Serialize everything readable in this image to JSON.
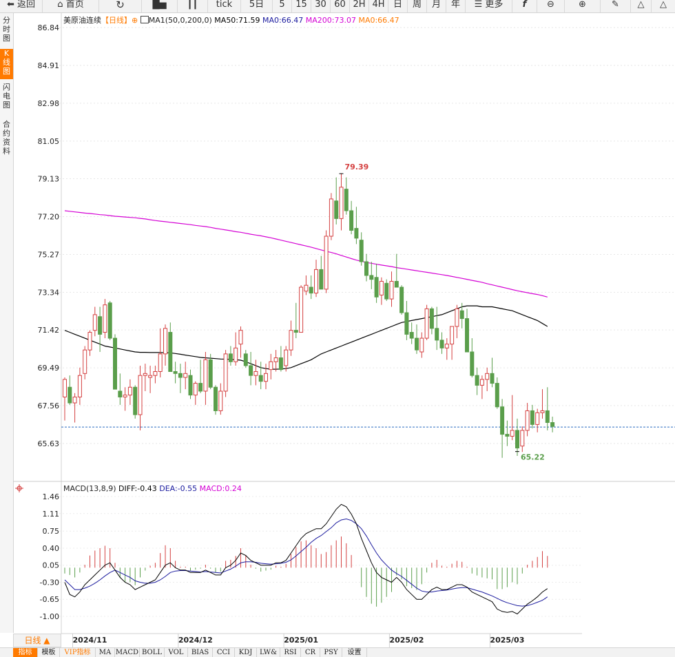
{
  "toolbar": {
    "back": "返回",
    "home": "首页",
    "tick": "tick",
    "d5": "5日",
    "m5": "5",
    "m15": "15",
    "m30": "30",
    "m60": "60",
    "h2": "2H",
    "h4": "4H",
    "day": "日",
    "week": "周",
    "month": "月",
    "year": "年",
    "more": "更多",
    "icons": [
      "back-arrow-icon",
      "home-icon",
      "refresh-icon",
      "bar-chart-icon",
      "candlestick-icon",
      "hamburger-icon",
      "function-icon",
      "zoom-out-icon",
      "zoom-in-icon",
      "pen-icon",
      "triangle-icon",
      "triangle-outline-icon"
    ]
  },
  "side_tabs": [
    {
      "label": "分时图",
      "active": false
    },
    {
      "label": "K线图",
      "active": true
    },
    {
      "label": "闪电图",
      "active": false
    },
    {
      "label": "合约资料",
      "active": false
    }
  ],
  "main_legend": {
    "symbol": "美原油连续",
    "period": "【日线】",
    "ma_params": "MA1(50,0,200,0)",
    "ma50": "MA50:71.59",
    "ma0": "MA0:66.47",
    "ma200": "MA200:73.07",
    "ma0b": "MA0:66.47"
  },
  "sub_legend": {
    "title": "MACD(13,8,9)",
    "diff": "DIFF:-0.43",
    "dea": "DEA:-0.55",
    "macd": "MACD:0.24"
  },
  "period_button": "日线 ▲",
  "bottom_tabs": [
    "指标",
    "模板",
    "VIP指标",
    "MA",
    "MACD",
    "BOLL",
    "VOL",
    "BIAS",
    "CCI",
    "KDJ",
    "LW&",
    "RSI",
    "CR",
    "PSY",
    "设置"
  ],
  "colors": {
    "up": "#d43f3f",
    "down": "#5a9e4b",
    "ma50": "#000000",
    "ma200": "#d400d4",
    "diff": "#000000",
    "dea": "#1a1a9e",
    "current_line": "#2a6cc0",
    "accent": "#ff7a00"
  },
  "chart_data": [
    {
      "type": "candlestick",
      "title": "美原油连续【日线】",
      "ylim": [
        65.0,
        87.5
      ],
      "yticks": [
        "86.84",
        "84.91",
        "82.98",
        "81.05",
        "79.13",
        "77.20",
        "75.27",
        "73.34",
        "71.42",
        "69.49",
        "67.56",
        "65.63"
      ],
      "x_labels": [
        "2024/11",
        "2024/12",
        "2025/01",
        "2025/02",
        "2025/03"
      ],
      "x_label_at": [
        5,
        26,
        47,
        68,
        88
      ],
      "current_price": 66.47,
      "high_label": "79.39",
      "high_index": 55,
      "low_label": "65.22",
      "low_index": 90,
      "ohlc": [
        [
          68.0,
          69.0,
          66.8,
          68.9
        ],
        [
          68.5,
          69.1,
          67.6,
          67.7
        ],
        [
          67.7,
          68.2,
          66.7,
          68.0
        ],
        [
          68.0,
          69.5,
          67.6,
          69.1
        ],
        [
          69.2,
          70.6,
          68.9,
          70.4
        ],
        [
          70.4,
          71.4,
          70.1,
          71.3
        ],
        [
          71.4,
          72.6,
          71.1,
          72.2
        ],
        [
          72.1,
          72.6,
          70.3,
          71.2
        ],
        [
          71.3,
          73.0,
          71.0,
          72.7
        ],
        [
          72.8,
          72.9,
          70.9,
          71.0
        ],
        [
          71.0,
          71.2,
          68.5,
          68.4
        ],
        [
          68.3,
          69.2,
          67.6,
          68.0
        ],
        [
          68.0,
          68.5,
          67.3,
          68.1
        ],
        [
          68.1,
          68.9,
          67.6,
          68.5
        ],
        [
          68.5,
          68.6,
          66.9,
          67.1
        ],
        [
          67.1,
          69.6,
          66.3,
          69.1
        ],
        [
          69.1,
          69.7,
          68.3,
          69.2
        ],
        [
          69.0,
          69.6,
          68.2,
          69.1
        ],
        [
          69.1,
          69.6,
          68.7,
          69.3
        ],
        [
          69.3,
          71.5,
          69.0,
          70.2
        ],
        [
          70.2,
          71.7,
          69.6,
          71.5
        ],
        [
          71.3,
          71.8,
          69.3,
          69.3
        ],
        [
          69.3,
          69.8,
          68.7,
          69.2
        ],
        [
          69.2,
          69.7,
          68.2,
          69.0
        ],
        [
          69.0,
          69.8,
          68.4,
          69.2
        ],
        [
          69.1,
          69.4,
          67.9,
          68.1
        ],
        [
          68.1,
          68.8,
          67.6,
          68.7
        ],
        [
          68.7,
          69.9,
          68.2,
          68.3
        ],
        [
          68.3,
          70.3,
          67.6,
          69.9
        ],
        [
          69.9,
          70.2,
          68.4,
          68.5
        ],
        [
          68.5,
          68.6,
          67.1,
          67.3
        ],
        [
          67.3,
          68.7,
          67.1,
          68.3
        ],
        [
          68.3,
          70.4,
          68.0,
          70.2
        ],
        [
          70.2,
          70.6,
          69.6,
          69.8
        ],
        [
          69.8,
          71.3,
          69.6,
          70.5
        ],
        [
          70.7,
          71.6,
          70.0,
          71.4
        ],
        [
          70.2,
          70.4,
          69.5,
          69.6
        ],
        [
          69.6,
          70.3,
          68.6,
          69.1
        ],
        [
          69.1,
          69.9,
          68.6,
          69.3
        ],
        [
          69.1,
          69.8,
          68.4,
          68.8
        ],
        [
          68.8,
          69.7,
          68.4,
          69.2
        ],
        [
          69.4,
          70.2,
          68.9,
          69.8
        ],
        [
          69.8,
          70.4,
          69.3,
          70.0
        ],
        [
          70.0,
          70.6,
          69.3,
          69.4
        ],
        [
          69.6,
          70.6,
          69.3,
          70.4
        ],
        [
          70.4,
          71.9,
          70.1,
          71.4
        ],
        [
          71.4,
          72.8,
          71.0,
          71.3
        ],
        [
          71.3,
          73.7,
          71.3,
          73.6
        ],
        [
          73.4,
          74.2,
          73.2,
          73.7
        ],
        [
          73.6,
          74.2,
          73.0,
          73.3
        ],
        [
          73.3,
          75.0,
          73.1,
          74.5
        ],
        [
          74.5,
          75.2,
          73.5,
          73.5
        ],
        [
          73.5,
          76.5,
          73.3,
          76.2
        ],
        [
          76.2,
          78.4,
          76.0,
          78.1
        ],
        [
          78.0,
          79.2,
          76.8,
          77.1
        ],
        [
          77.1,
          79.39,
          76.5,
          78.7
        ],
        [
          78.6,
          79.2,
          77.3,
          77.5
        ],
        [
          77.5,
          78.0,
          76.3,
          76.5
        ],
        [
          76.6,
          77.7,
          75.8,
          76.1
        ],
        [
          76.0,
          76.4,
          74.7,
          74.9
        ],
        [
          74.9,
          75.3,
          73.9,
          74.2
        ],
        [
          74.2,
          74.9,
          73.5,
          74.0
        ],
        [
          74.1,
          74.8,
          72.8,
          73.1
        ],
        [
          73.2,
          74.1,
          72.7,
          73.9
        ],
        [
          73.8,
          74.0,
          72.9,
          73.0
        ],
        [
          73.0,
          74.4,
          72.6,
          73.9
        ],
        [
          73.9,
          75.3,
          73.6,
          73.6
        ],
        [
          73.6,
          73.7,
          72.2,
          72.3
        ],
        [
          72.3,
          72.9,
          70.9,
          71.2
        ],
        [
          71.3,
          71.8,
          70.7,
          71.0
        ],
        [
          71.0,
          71.7,
          70.2,
          70.4
        ],
        [
          70.3,
          71.3,
          70.0,
          71.0
        ],
        [
          71.0,
          72.7,
          70.9,
          72.5
        ],
        [
          72.5,
          72.6,
          71.2,
          71.5
        ],
        [
          71.5,
          72.6,
          70.4,
          70.9
        ],
        [
          70.9,
          71.3,
          70.2,
          70.5
        ],
        [
          70.5,
          71.0,
          69.9,
          70.7
        ],
        [
          70.7,
          71.6,
          69.9,
          71.6
        ],
        [
          71.6,
          72.7,
          71.0,
          72.5
        ],
        [
          72.4,
          72.8,
          71.5,
          72.0
        ],
        [
          72.0,
          72.5,
          70.3,
          70.3
        ],
        [
          70.3,
          71.0,
          69.0,
          69.1
        ],
        [
          69.1,
          69.5,
          68.1,
          68.6
        ],
        [
          68.6,
          69.1,
          67.9,
          68.9
        ],
        [
          68.9,
          69.5,
          68.3,
          69.2
        ],
        [
          69.2,
          70.0,
          68.5,
          68.7
        ],
        [
          68.7,
          69.0,
          67.4,
          67.5
        ],
        [
          67.5,
          67.9,
          64.9,
          66.1
        ],
        [
          66.1,
          66.8,
          65.5,
          66.0
        ],
        [
          66.0,
          68.1,
          65.8,
          66.3
        ],
        [
          66.3,
          66.9,
          65.0,
          65.4
        ],
        [
          65.5,
          66.5,
          65.2,
          66.3
        ],
        [
          66.3,
          67.7,
          66.0,
          67.3
        ],
        [
          67.3,
          67.6,
          66.4,
          66.6
        ],
        [
          66.6,
          67.4,
          66.2,
          67.2
        ],
        [
          67.2,
          68.4,
          66.9,
          67.3
        ],
        [
          67.3,
          68.5,
          66.3,
          66.7
        ],
        [
          66.7,
          67.0,
          66.2,
          66.5
        ]
      ],
      "ma50": [
        71.4,
        71.3,
        71.2,
        71.1,
        71.0,
        70.9,
        70.8,
        70.7,
        70.6,
        70.55,
        70.5,
        70.45,
        70.4,
        70.35,
        70.3,
        70.28,
        70.28,
        70.27,
        70.27,
        70.27,
        70.26,
        70.25,
        70.22,
        70.18,
        70.14,
        70.1,
        70.06,
        70.02,
        70.0,
        69.98,
        69.96,
        69.94,
        69.93,
        69.92,
        69.9,
        69.88,
        69.8,
        69.7,
        69.6,
        69.5,
        69.45,
        69.42,
        69.42,
        69.43,
        69.45,
        69.5,
        69.6,
        69.7,
        69.8,
        69.9,
        70.05,
        70.2,
        70.3,
        70.4,
        70.5,
        70.6,
        70.7,
        70.8,
        70.9,
        71.0,
        71.1,
        71.2,
        71.3,
        71.4,
        71.5,
        71.6,
        71.7,
        71.8,
        71.85,
        71.9,
        71.95,
        72.0,
        72.05,
        72.1,
        72.15,
        72.2,
        72.3,
        72.4,
        72.5,
        72.6,
        72.65,
        72.65,
        72.65,
        72.6,
        72.6,
        72.6,
        72.55,
        72.5,
        72.45,
        72.4,
        72.3,
        72.2,
        72.1,
        72.0,
        71.9,
        71.75,
        71.6
      ],
      "ma200": [
        77.5,
        77.47,
        77.44,
        77.41,
        77.38,
        77.36,
        77.33,
        77.3,
        77.28,
        77.25,
        77.22,
        77.2,
        77.18,
        77.16,
        77.14,
        77.11,
        77.08,
        77.04,
        77.0,
        76.97,
        76.94,
        76.91,
        76.88,
        76.85,
        76.82,
        76.79,
        76.75,
        76.72,
        76.69,
        76.65,
        76.6,
        76.56,
        76.52,
        76.48,
        76.43,
        76.4,
        76.35,
        76.3,
        76.26,
        76.22,
        76.17,
        76.12,
        76.06,
        76.0,
        75.94,
        75.88,
        75.82,
        75.76,
        75.7,
        75.64,
        75.57,
        75.5,
        75.43,
        75.37,
        75.3,
        75.22,
        75.14,
        75.06,
        74.98,
        74.92,
        74.86,
        74.82,
        74.77,
        74.73,
        74.69,
        74.65,
        74.6,
        74.56,
        74.52,
        74.48,
        74.44,
        74.4,
        74.36,
        74.32,
        74.28,
        74.24,
        74.2,
        74.15,
        74.1,
        74.05,
        74.0,
        73.95,
        73.9,
        73.85,
        73.78,
        73.72,
        73.66,
        73.6,
        73.54,
        73.48,
        73.42,
        73.37,
        73.32,
        73.27,
        73.23,
        73.17,
        73.1
      ]
    },
    {
      "type": "macd",
      "title": "MACD(13,8,9)",
      "ylim": [
        -1.3,
        1.6
      ],
      "yticks": [
        "1.46",
        "1.11",
        "0.75",
        "0.40",
        "0.05",
        "-0.30",
        "-0.65",
        "-1.00"
      ],
      "diff": [
        -0.3,
        -0.55,
        -0.6,
        -0.5,
        -0.35,
        -0.25,
        -0.15,
        -0.05,
        0.05,
        0.1,
        -0.05,
        -0.2,
        -0.3,
        -0.35,
        -0.45,
        -0.4,
        -0.35,
        -0.3,
        -0.25,
        -0.1,
        0.05,
        0.1,
        0.0,
        -0.05,
        -0.05,
        -0.1,
        -0.1,
        -0.1,
        -0.05,
        -0.1,
        -0.15,
        -0.15,
        0.0,
        0.05,
        0.15,
        0.3,
        0.25,
        0.15,
        0.1,
        0.05,
        0.05,
        0.05,
        0.1,
        0.1,
        0.15,
        0.3,
        0.45,
        0.6,
        0.7,
        0.75,
        0.8,
        0.8,
        0.9,
        1.05,
        1.2,
        1.3,
        1.25,
        1.1,
        0.9,
        0.6,
        0.35,
        0.1,
        -0.1,
        -0.2,
        -0.25,
        -0.3,
        -0.2,
        -0.3,
        -0.45,
        -0.55,
        -0.65,
        -0.65,
        -0.55,
        -0.45,
        -0.4,
        -0.45,
        -0.45,
        -0.4,
        -0.35,
        -0.35,
        -0.4,
        -0.5,
        -0.55,
        -0.6,
        -0.65,
        -0.7,
        -0.85,
        -0.9,
        -0.92,
        -0.9,
        -0.95,
        -0.85,
        -0.75,
        -0.68,
        -0.6,
        -0.5,
        -0.43
      ],
      "dea": [
        -0.25,
        -0.35,
        -0.45,
        -0.45,
        -0.42,
        -0.38,
        -0.32,
        -0.25,
        -0.17,
        -0.1,
        -0.05,
        -0.1,
        -0.15,
        -0.2,
        -0.27,
        -0.3,
        -0.32,
        -0.32,
        -0.3,
        -0.25,
        -0.18,
        -0.1,
        -0.07,
        -0.06,
        -0.06,
        -0.07,
        -0.08,
        -0.09,
        -0.08,
        -0.09,
        -0.1,
        -0.11,
        -0.07,
        -0.03,
        0.03,
        0.1,
        0.12,
        0.12,
        0.11,
        0.09,
        0.08,
        0.07,
        0.08,
        0.09,
        0.11,
        0.16,
        0.24,
        0.33,
        0.42,
        0.52,
        0.6,
        0.66,
        0.74,
        0.82,
        0.92,
        0.98,
        1.0,
        0.97,
        0.9,
        0.8,
        0.65,
        0.47,
        0.3,
        0.16,
        0.05,
        -0.05,
        -0.12,
        -0.18,
        -0.26,
        -0.34,
        -0.42,
        -0.48,
        -0.5,
        -0.5,
        -0.48,
        -0.47,
        -0.46,
        -0.44,
        -0.42,
        -0.41,
        -0.41,
        -0.44,
        -0.47,
        -0.5,
        -0.54,
        -0.58,
        -0.63,
        -0.68,
        -0.72,
        -0.75,
        -0.78,
        -0.79,
        -0.78,
        -0.75,
        -0.71,
        -0.67,
        -0.6
      ],
      "macd": [
        -0.12,
        -0.15,
        -0.2,
        -0.1,
        0.06,
        0.25,
        0.35,
        0.4,
        0.45,
        0.4,
        0.1,
        -0.2,
        -0.3,
        -0.3,
        -0.36,
        -0.2,
        -0.06,
        0.04,
        0.1,
        0.3,
        0.46,
        0.4,
        0.14,
        0.02,
        0.02,
        -0.06,
        -0.04,
        -0.02,
        0.06,
        -0.02,
        -0.1,
        -0.08,
        0.14,
        0.16,
        0.24,
        0.4,
        0.26,
        0.06,
        -0.02,
        -0.08,
        -0.06,
        -0.04,
        0.04,
        0.02,
        0.08,
        0.28,
        0.42,
        0.54,
        0.56,
        0.46,
        0.4,
        0.28,
        0.32,
        0.46,
        0.56,
        0.64,
        0.5,
        0.26,
        0.0,
        -0.4,
        -0.6,
        -0.74,
        -0.8,
        -0.72,
        -0.6,
        -0.5,
        -0.16,
        -0.24,
        -0.38,
        -0.42,
        -0.46,
        -0.34,
        -0.1,
        0.1,
        0.16,
        0.04,
        0.02,
        0.08,
        0.14,
        0.12,
        0.02,
        -0.12,
        -0.16,
        -0.2,
        -0.22,
        -0.24,
        -0.44,
        -0.44,
        -0.4,
        -0.3,
        -0.34,
        -0.12,
        0.06,
        0.14,
        0.22,
        0.34,
        0.24
      ]
    }
  ]
}
